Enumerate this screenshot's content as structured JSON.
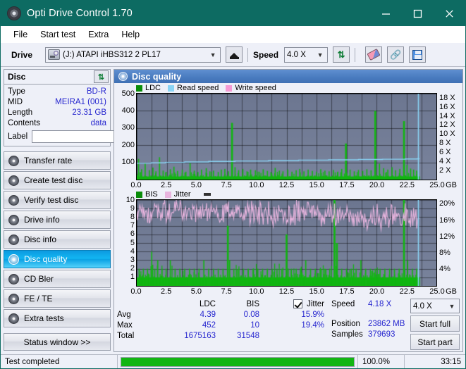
{
  "window": {
    "title": "Opti Drive Control 1.70",
    "icon": "disc-icon",
    "minimize": "−",
    "maximize": "□",
    "close": "✕"
  },
  "menu": [
    "File",
    "Start test",
    "Extra",
    "Help"
  ],
  "toolbar": {
    "drive_label": "Drive",
    "drive_value": "(J:)   ATAPI iHBS312   2 PL17",
    "eject_title": "Eject",
    "speed_label": "Speed",
    "speed_value": "4.0 X",
    "refresh_title": "Refresh",
    "erase_title": "Erase",
    "chain_title": "Link",
    "save_title": "Save"
  },
  "disc": {
    "header": "Disc",
    "rows": [
      {
        "key": "Type",
        "value": "BD-R"
      },
      {
        "key": "MID",
        "value": "MEIRA1 (001)"
      },
      {
        "key": "Length",
        "value": "23.31 GB"
      },
      {
        "key": "Contents",
        "value": "data"
      }
    ],
    "label_key": "Label",
    "label_value": ""
  },
  "sidebar": {
    "items": [
      {
        "label": "Transfer rate",
        "selected": false
      },
      {
        "label": "Create test disc",
        "selected": false
      },
      {
        "label": "Verify test disc",
        "selected": false
      },
      {
        "label": "Drive info",
        "selected": false
      },
      {
        "label": "Disc info",
        "selected": false
      },
      {
        "label": "Disc quality",
        "selected": true
      },
      {
        "label": "CD Bler",
        "selected": false
      },
      {
        "label": "FE / TE",
        "selected": false
      },
      {
        "label": "Extra tests",
        "selected": false
      }
    ],
    "status_button": "Status window >>"
  },
  "main": {
    "header": "Disc quality"
  },
  "stats": {
    "col_ldc": "LDC",
    "col_bis": "BIS",
    "col_jitter": "Jitter",
    "jitter_checked": true,
    "rows": [
      {
        "name": "Avg",
        "ldc": "4.39",
        "bis": "0.08",
        "jitter": "15.9%"
      },
      {
        "name": "Max",
        "ldc": "452",
        "bis": "10",
        "jitter": "19.4%"
      },
      {
        "name": "Total",
        "ldc": "1675163",
        "bis": "31548",
        "jitter": ""
      }
    ]
  },
  "readout": {
    "speed_label": "Speed",
    "speed_value": "4.18 X",
    "position_label": "Position",
    "position_value": "23862 MB",
    "samples_label": "Samples",
    "samples_value": "379693",
    "speed_select": "4.0 X",
    "start_full": "Start full",
    "start_part": "Start part"
  },
  "statusbar": {
    "message": "Test completed",
    "percent_text": "100.0%",
    "percent_value": 100,
    "elapsed": "33:15"
  },
  "colors": {
    "titlebar": "#0d6b62",
    "accent_blue": "#3f70b4",
    "ldc_green": "#12b512",
    "read_speed": "#8ad4f5",
    "write_speed": "#f59ad4",
    "bis_green": "#12b512",
    "jitter_pink": "#e8b4de",
    "value_blue": "#2727cf",
    "plot_bg": "#727c96"
  },
  "chart_data": [
    {
      "type": "line",
      "title": "Disc quality - LDC / speed",
      "xlabel": "GB",
      "ylabel": "LDC",
      "y2label": "X",
      "grid": true,
      "legend": [
        {
          "label": "LDC",
          "color": "#0a8c0a"
        },
        {
          "label": "Read speed",
          "color": "#8ad4f5"
        },
        {
          "label": "Write speed",
          "color": "#f59ad4"
        }
      ],
      "x": [
        0.0,
        2.5,
        5.0,
        7.5,
        10.0,
        12.5,
        15.0,
        17.5,
        20.0,
        22.5,
        25.0
      ],
      "xlim": [
        0,
        25
      ],
      "xticks": [
        "0.0",
        "2.5",
        "5.0",
        "7.5",
        "10.0",
        "12.5",
        "15.0",
        "17.5",
        "20.0",
        "22.5",
        "25.0"
      ],
      "ylim": [
        0,
        500
      ],
      "yticks": [
        100,
        200,
        300,
        400,
        500
      ],
      "y2lim": [
        0,
        19
      ],
      "y2ticks": [
        "2 X",
        "4 X",
        "6 X",
        "8 X",
        "10 X",
        "12 X",
        "14 X",
        "16 X",
        "18 X"
      ],
      "series": [
        {
          "name": "LDC",
          "color": "#12b512",
          "style": "spikes",
          "baseline": 18,
          "peaks": [
            [
              0.15,
              120
            ],
            [
              0.4,
              60
            ],
            [
              0.7,
              95
            ],
            [
              1.05,
              55
            ],
            [
              1.35,
              70
            ],
            [
              1.6,
              48
            ],
            [
              1.9,
              130
            ],
            [
              2.2,
              52
            ],
            [
              2.45,
              45
            ],
            [
              2.8,
              60
            ],
            [
              3.1,
              75
            ],
            [
              3.4,
              50
            ],
            [
              3.8,
              58
            ],
            [
              4.1,
              46
            ],
            [
              4.45,
              95
            ],
            [
              4.8,
              52
            ],
            [
              5.1,
              44
            ],
            [
              5.4,
              58
            ],
            [
              5.8,
              66
            ],
            [
              6.1,
              48
            ],
            [
              6.4,
              52
            ],
            [
              6.8,
              44
            ],
            [
              7.05,
              58
            ],
            [
              7.35,
              62
            ],
            [
              7.65,
              48
            ],
            [
              7.95,
              330
            ],
            [
              8.2,
              72
            ],
            [
              8.5,
              55
            ],
            [
              8.85,
              62
            ],
            [
              9.2,
              48
            ],
            [
              9.5,
              58
            ],
            [
              9.9,
              54
            ],
            [
              10.2,
              46
            ],
            [
              10.55,
              60
            ],
            [
              10.9,
              50
            ],
            [
              11.2,
              44
            ],
            [
              11.55,
              68
            ],
            [
              11.9,
              52
            ],
            [
              12.2,
              48
            ],
            [
              12.6,
              58
            ],
            [
              12.95,
              46
            ],
            [
              13.3,
              54
            ],
            [
              13.6,
              62
            ],
            [
              13.95,
              48
            ],
            [
              14.3,
              58
            ],
            [
              14.65,
              50
            ],
            [
              15.0,
              46
            ],
            [
              15.35,
              60
            ],
            [
              15.7,
              52
            ],
            [
              16.05,
              48
            ],
            [
              16.4,
              56
            ],
            [
              16.75,
              44
            ],
            [
              17.1,
              62
            ],
            [
              17.45,
              210
            ],
            [
              17.8,
              58
            ],
            [
              18.15,
              48
            ],
            [
              18.5,
              56
            ],
            [
              18.85,
              50
            ],
            [
              19.2,
              60
            ],
            [
              19.55,
              54
            ],
            [
              19.9,
              400
            ],
            [
              20.25,
              92
            ],
            [
              20.6,
              66
            ],
            [
              20.95,
              58
            ],
            [
              21.3,
              72
            ],
            [
              21.6,
              54
            ],
            [
              21.95,
              62
            ],
            [
              22.3,
              340
            ],
            [
              22.55,
              86
            ],
            [
              22.85,
              64
            ],
            [
              23.1,
              58
            ],
            [
              23.35,
              52
            ]
          ]
        },
        {
          "name": "Read speed",
          "color": "#8ad4f5",
          "style": "step-line",
          "points": [
            [
              0.0,
              3.6
            ],
            [
              1.2,
              3.7
            ],
            [
              2.4,
              3.8
            ],
            [
              4.0,
              3.9
            ],
            [
              6.0,
              4.0
            ],
            [
              8.2,
              4.1
            ],
            [
              11.0,
              4.2
            ],
            [
              13.5,
              4.3
            ],
            [
              16.0,
              4.35
            ],
            [
              18.5,
              4.45
            ],
            [
              20.5,
              4.5
            ],
            [
              22.4,
              4.55
            ],
            [
              23.4,
              4.6
            ]
          ]
        },
        {
          "name": "Write speed",
          "color": "#f59ad4",
          "style": "none",
          "points": []
        }
      ],
      "marker_line": {
        "x": 23.45,
        "color": "#8ad4f5"
      },
      "data_end_x": 23.6
    },
    {
      "type": "line",
      "title": "Disc quality - BIS / jitter",
      "xlabel": "GB",
      "ylabel": "BIS",
      "y2label": "%",
      "grid": true,
      "legend": [
        {
          "label": "BIS",
          "color": "#0a8c0a"
        },
        {
          "label": "Jitter",
          "color": "#e8b4de"
        }
      ],
      "xlim": [
        0,
        25
      ],
      "xticks": [
        "0.0",
        "2.5",
        "5.0",
        "7.5",
        "10.0",
        "12.5",
        "15.0",
        "17.5",
        "20.0",
        "22.5",
        "25.0"
      ],
      "ylim": [
        0,
        10
      ],
      "yticks": [
        1,
        2,
        3,
        4,
        5,
        6,
        7,
        8,
        9,
        10
      ],
      "y2lim": [
        0,
        21
      ],
      "y2ticks": [
        "4%",
        "8%",
        "12%",
        "16%",
        "20%"
      ],
      "series": [
        {
          "name": "BIS",
          "color": "#12b512",
          "style": "spikes",
          "baseline": 1.0,
          "peaks": [
            [
              0.2,
              2.0
            ],
            [
              0.55,
              2.0
            ],
            [
              0.9,
              2.0
            ],
            [
              1.25,
              4.0
            ],
            [
              1.5,
              2.0
            ],
            [
              1.75,
              3.0
            ],
            [
              2.1,
              2.0
            ],
            [
              2.45,
              2.0
            ],
            [
              2.8,
              3.0
            ],
            [
              3.2,
              2.0
            ],
            [
              3.6,
              2.0
            ],
            [
              4.0,
              2.0
            ],
            [
              4.4,
              2.0
            ],
            [
              4.8,
              2.0
            ],
            [
              5.2,
              2.0
            ],
            [
              5.6,
              3.0
            ],
            [
              6.0,
              2.0
            ],
            [
              6.4,
              2.0
            ],
            [
              6.8,
              2.0
            ],
            [
              7.2,
              2.0
            ],
            [
              7.6,
              7.0
            ],
            [
              7.75,
              3.0
            ],
            [
              8.1,
              2.0
            ],
            [
              8.5,
              2.0
            ],
            [
              8.9,
              2.0
            ],
            [
              9.3,
              2.0
            ],
            [
              9.7,
              2.0
            ],
            [
              10.1,
              2.0
            ],
            [
              10.5,
              2.0
            ],
            [
              10.9,
              2.0
            ],
            [
              11.3,
              2.0
            ],
            [
              11.7,
              2.0
            ],
            [
              12.1,
              2.0
            ],
            [
              12.5,
              6.0
            ],
            [
              12.9,
              2.0
            ],
            [
              13.3,
              2.0
            ],
            [
              13.7,
              2.0
            ],
            [
              14.1,
              3.0
            ],
            [
              14.5,
              2.0
            ],
            [
              14.9,
              2.0
            ],
            [
              15.3,
              2.0
            ],
            [
              15.7,
              2.0
            ],
            [
              16.1,
              2.0
            ],
            [
              16.5,
              10.0
            ],
            [
              16.7,
              5.0
            ],
            [
              17.1,
              2.0
            ],
            [
              17.5,
              2.0
            ],
            [
              17.9,
              2.0
            ],
            [
              18.3,
              2.0
            ],
            [
              18.7,
              3.0
            ],
            [
              19.1,
              2.0
            ],
            [
              19.5,
              2.0
            ],
            [
              19.9,
              2.0
            ],
            [
              20.3,
              2.0
            ],
            [
              20.7,
              2.0
            ],
            [
              21.1,
              2.0
            ],
            [
              21.5,
              2.0
            ],
            [
              21.9,
              2.0
            ],
            [
              22.3,
              10.0
            ],
            [
              22.6,
              3.0
            ],
            [
              23.0,
              2.0
            ],
            [
              23.35,
              2.0
            ]
          ]
        },
        {
          "name": "Jitter",
          "color": "#e8b4de",
          "style": "noise-line",
          "mean_percent": 15.9,
          "band_percent": [
            13.5,
            19.4
          ],
          "plot_mean_y": 8.4,
          "plot_band": [
            7.0,
            9.8
          ]
        }
      ],
      "marker_line": {
        "x": 23.45,
        "color": "#8ad4f5"
      },
      "data_end_x": 23.6
    }
  ]
}
